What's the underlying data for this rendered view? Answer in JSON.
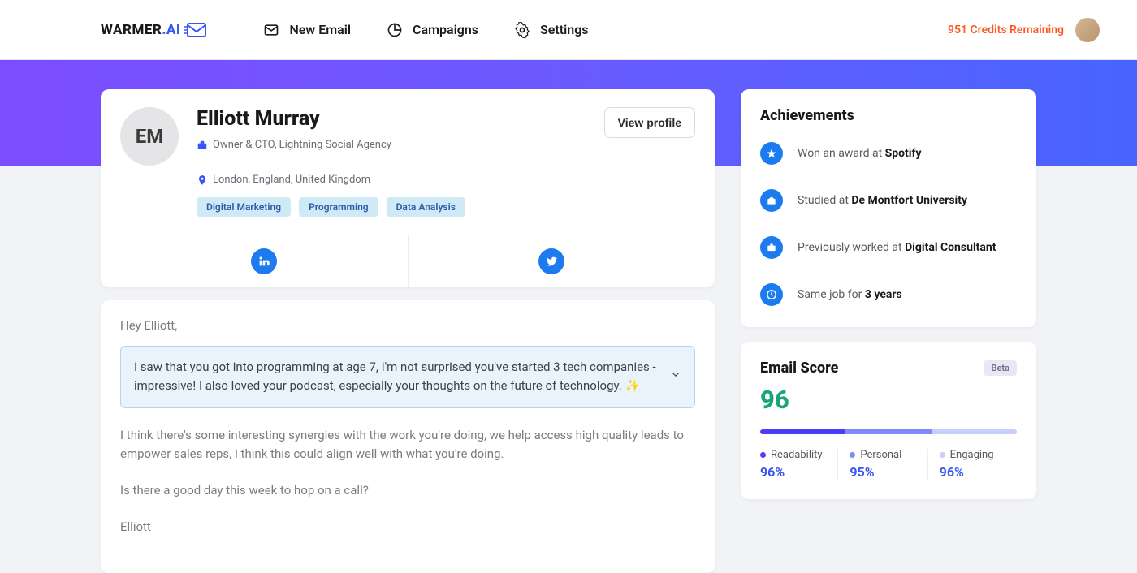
{
  "brand": {
    "name": "WARMER",
    "suffix": ".AI"
  },
  "nav": {
    "new_email": "New Email",
    "campaigns": "Campaigns",
    "settings": "Settings"
  },
  "header": {
    "credits": "951 Credits Remaining"
  },
  "profile": {
    "initials": "EM",
    "name": "Elliott Murray",
    "role": "Owner & CTO, Lightning Social Agency",
    "location": "London, England, United Kingdom",
    "tags": [
      "Digital Marketing",
      "Programming",
      "Data Analysis"
    ],
    "view_btn": "View profile"
  },
  "email": {
    "greeting": "Hey Elliott,",
    "highlight": "I saw that you got into programming at age 7, I'm not surprised you've started 3 tech companies - impressive! I also loved your podcast, especially your thoughts on the future of technology. ✨",
    "body1": "I think there's some interesting synergies with the work you're doing, we help access high quality leads to empower sales reps, I think this could align well with what you're doing.",
    "body2": "Is there a good day this week to hop on a call?",
    "signoff": "Elliott"
  },
  "achievements": {
    "title": "Achievements",
    "items": [
      {
        "pre": "Won an award at ",
        "strong": "Spotify"
      },
      {
        "pre": "Studied at ",
        "strong": "De Montfort University"
      },
      {
        "pre": "Previously worked at ",
        "strong": "Digital Consultant"
      },
      {
        "pre": "Same job for ",
        "strong": "3 years"
      }
    ]
  },
  "score": {
    "title": "Email Score",
    "badge": "Beta",
    "value": "96",
    "bar_colors": [
      "#4a3df5",
      "#7e8cf8",
      "#c6cefc"
    ],
    "metrics": [
      {
        "label": "Readability",
        "value": "96%",
        "color": "#4a3df5"
      },
      {
        "label": "Personal",
        "value": "95%",
        "color": "#7e8cf8"
      },
      {
        "label": "Engaging",
        "value": "96%",
        "color": "#c6cefc"
      }
    ]
  }
}
